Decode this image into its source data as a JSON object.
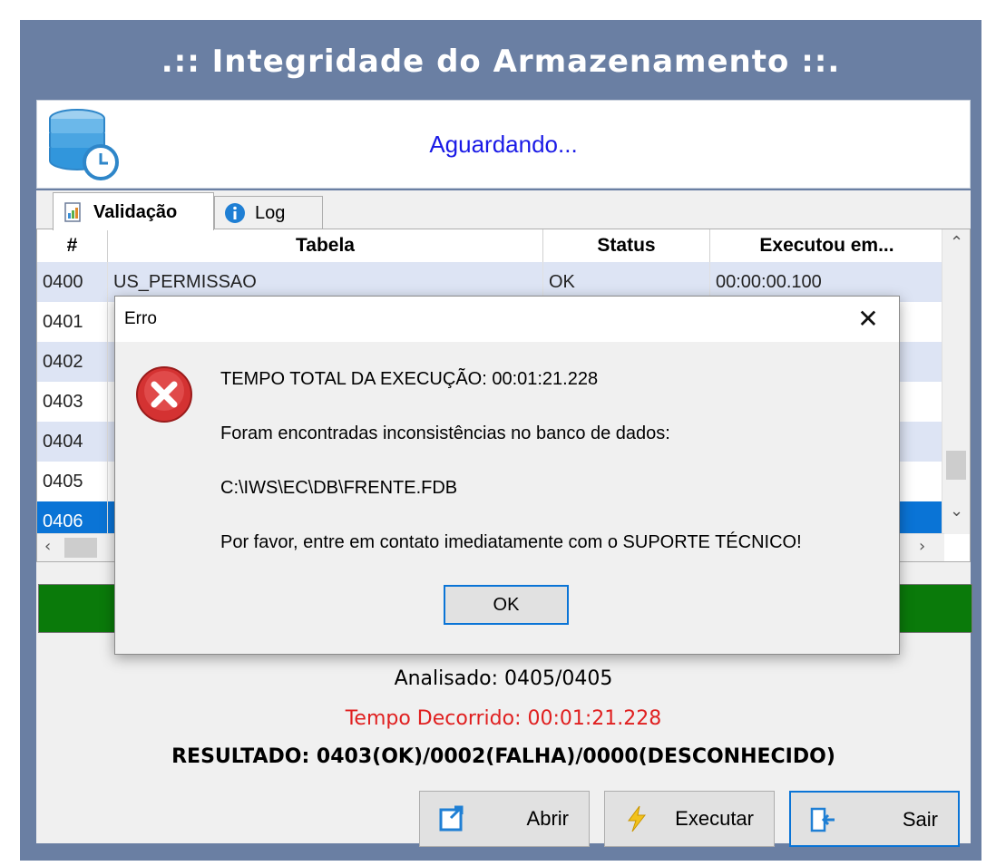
{
  "window": {
    "title": ".:: Integridade do Armazenamento ::.",
    "status": "Aguardando..."
  },
  "tabs": [
    {
      "label": "Validação",
      "icon": "report-icon",
      "active": true
    },
    {
      "label": "Log",
      "icon": "info-icon",
      "active": false
    }
  ],
  "grid": {
    "columns": [
      "#",
      "Tabela",
      "Status",
      "Executou em..."
    ],
    "rows": [
      {
        "num": "0400",
        "tabela": "US_PERMISSAO",
        "status": "OK",
        "executou": "00:00:00.100"
      },
      {
        "num": "0401",
        "tabela": "",
        "status": "",
        "executou": ""
      },
      {
        "num": "0402",
        "tabela": "",
        "status": "",
        "executou": ""
      },
      {
        "num": "0403",
        "tabela": "",
        "status": "",
        "executou": ""
      },
      {
        "num": "0404",
        "tabela": "",
        "status": "",
        "executou": ""
      },
      {
        "num": "0405",
        "tabela": "",
        "status": "",
        "executou": ""
      },
      {
        "num": "0406",
        "tabela": "",
        "status": "",
        "executou": ""
      }
    ]
  },
  "progress": {
    "value_fraction": 1.0,
    "color": "#0a7a0a"
  },
  "stats": {
    "analisado": "Analisado: 0405/0405",
    "tempo": "Tempo Decorrido: 00:01:21.228",
    "resultado": "RESULTADO: 0403(OK)/0002(FALHA)/0000(DESCONHECIDO)"
  },
  "buttons": {
    "abrir": "Abrir",
    "executar": "Executar",
    "sair": "Sair"
  },
  "dialog": {
    "title": "Erro",
    "close": "✕",
    "lines": [
      "TEMPO TOTAL DA EXECUÇÃO: 00:01:21.228",
      "Foram encontradas inconsistências no banco de dados:",
      "C:\\IWS\\EC\\DB\\FRENTE.FDB",
      "Por favor, entre em contato imediatamente com o SUPORTE TÉCNICO!"
    ],
    "ok": "OK"
  },
  "colors": {
    "frame": "#6a7fa3",
    "status_text": "#1a1ae6",
    "selected_row": "#0a74d6",
    "alt_row": "#dde4f4",
    "tempo_text": "#e02020"
  }
}
